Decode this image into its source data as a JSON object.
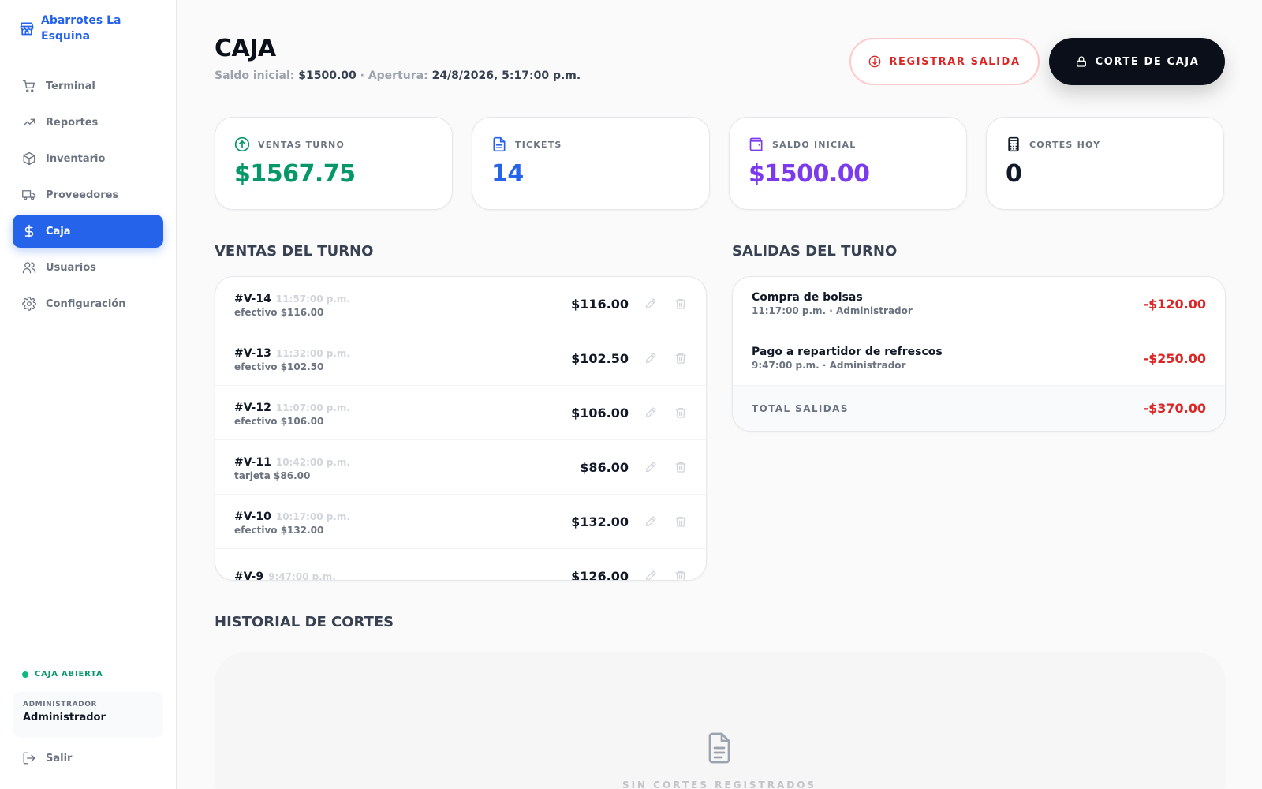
{
  "app": {
    "name": "Abarrotes La Esquina"
  },
  "sidebar": {
    "items": [
      {
        "label": "Terminal",
        "icon": "cart-icon",
        "active": false
      },
      {
        "label": "Reportes",
        "icon": "trending-icon",
        "active": false
      },
      {
        "label": "Inventario",
        "icon": "box-icon",
        "active": false
      },
      {
        "label": "Proveedores",
        "icon": "truck-icon",
        "active": false
      },
      {
        "label": "Caja",
        "icon": "dollar-icon",
        "active": true
      },
      {
        "label": "Usuarios",
        "icon": "users-icon",
        "active": false
      },
      {
        "label": "Configuración",
        "icon": "gear-icon",
        "active": false
      }
    ],
    "status": "CAJA ABIERTA",
    "user_role": "ADMINISTRADOR",
    "user_name": "Administrador",
    "logout": "Salir"
  },
  "header": {
    "title": "CAJA",
    "opening_label": "Saldo inicial:",
    "opening_value": "$1500.00",
    "separator": "·",
    "opened_label": "Apertura:",
    "opened_value": "24/8/2026, 5:17:00 p.m.",
    "btn_exit": "REGISTRAR SALIDA",
    "btn_cut": "CORTE DE CAJA"
  },
  "cards": [
    {
      "label": "VENTAS TURNO",
      "value": "$1567.75",
      "color": "#059669",
      "icon": "arrow-up-circle-icon"
    },
    {
      "label": "TICKETS",
      "value": "14",
      "color": "#2563eb",
      "icon": "document-icon"
    },
    {
      "label": "SALDO INICIAL",
      "value": "$1500.00",
      "color": "#7c3aed",
      "icon": "wallet-icon"
    },
    {
      "label": "CORTES HOY",
      "value": "0",
      "color": "#111827",
      "icon": "calculator-icon"
    }
  ],
  "sales": {
    "title": "VENTAS DEL TURNO",
    "rows": [
      {
        "id": "#V-14",
        "time": "11:57:00 p.m.",
        "method": "efectivo $116.00",
        "amount": "$116.00"
      },
      {
        "id": "#V-13",
        "time": "11:32:00 p.m.",
        "method": "efectivo $102.50",
        "amount": "$102.50"
      },
      {
        "id": "#V-12",
        "time": "11:07:00 p.m.",
        "method": "efectivo $106.00",
        "amount": "$106.00"
      },
      {
        "id": "#V-11",
        "time": "10:42:00 p.m.",
        "method": "tarjeta $86.00",
        "amount": "$86.00"
      },
      {
        "id": "#V-10",
        "time": "10:17:00 p.m.",
        "method": "efectivo $132.00",
        "amount": "$132.00"
      },
      {
        "id": "#V-9",
        "time": "9:47:00 p.m.",
        "method": "",
        "amount": "$126.00"
      }
    ]
  },
  "outflows": {
    "title": "SALIDAS DEL TURNO",
    "rows": [
      {
        "desc": "Compra de bolsas",
        "meta": "11:17:00 p.m. · Administrador",
        "amount": "-$120.00"
      },
      {
        "desc": "Pago a repartidor de refrescos",
        "meta": "9:47:00 p.m. · Administrador",
        "amount": "-$250.00"
      }
    ],
    "total_label": "TOTAL SALIDAS",
    "total_value": "-$370.00"
  },
  "history": {
    "title": "HISTORIAL DE CORTES",
    "empty": "SIN CORTES REGISTRADOS"
  },
  "colors": {
    "accent": "#2563eb",
    "danger": "#dc2626",
    "success": "#059669",
    "dark": "#0b0f19"
  }
}
